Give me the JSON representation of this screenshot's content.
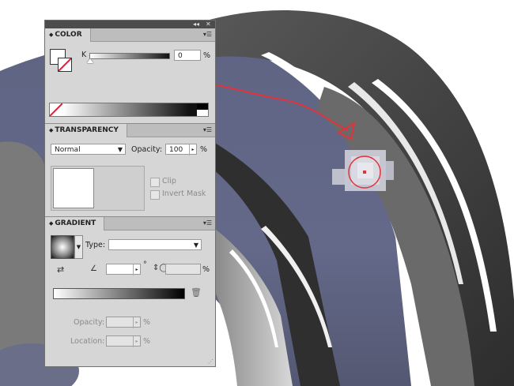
{
  "color_panel": {
    "title": "COLOR",
    "channel_label": "K",
    "channel_value": "0",
    "percent": "%"
  },
  "transparency_panel": {
    "title": "TRANSPARENCY",
    "blend_mode": "Normal",
    "opacity_label": "Opacity:",
    "opacity_value": "100",
    "percent": "%",
    "clip_label": "Clip",
    "invert_mask_label": "Invert Mask"
  },
  "gradient_panel": {
    "title": "GRADIENT",
    "type_label": "Type:",
    "type_value": "",
    "angle_value": "",
    "degree_symbol": "°",
    "aspect_value": "",
    "percent": "%",
    "opacity_label": "Opacity:",
    "location_label": "Location:",
    "opacity_percent": "%",
    "location_percent": "%"
  },
  "dock": {
    "collapse_icon": "double-chevron",
    "close_icon": "close"
  },
  "colors": {
    "panel_bg": "#d6d6d6",
    "header_bg": "#bdbdbd",
    "annotation_red": "#e2323c"
  }
}
